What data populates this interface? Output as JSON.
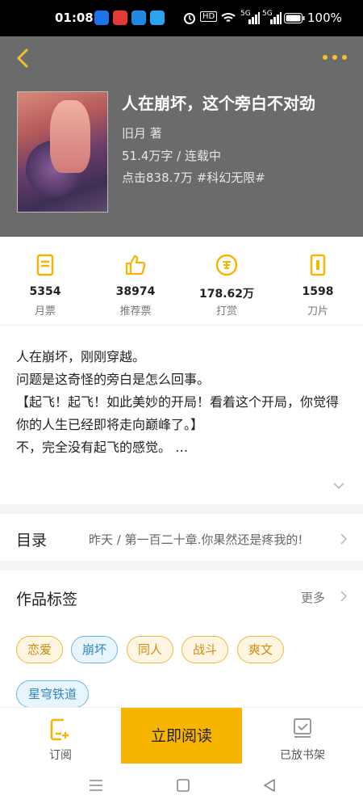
{
  "status_bar": {
    "time": "01:08",
    "battery": "100%",
    "signal_labels": [
      "HD",
      "5G",
      "5G"
    ]
  },
  "book": {
    "title": "人在崩坏，这个旁白不对劲",
    "author": "旧月  著",
    "words_status": "51.4万字 / 连载中",
    "clicks_tag": "点击838.7万  #科幻无限#"
  },
  "stats": [
    {
      "num": "5354",
      "label": "月票",
      "icon": "ticket-icon"
    },
    {
      "num": "38974",
      "label": "推荐票",
      "icon": "thumbs-up-icon"
    },
    {
      "num": "178.62万",
      "label": "打赏",
      "icon": "reward-coin-icon"
    },
    {
      "num": "1598",
      "label": "刀片",
      "icon": "blade-icon"
    }
  ],
  "description": [
    "人在崩坏，刚刚穿越。",
    "问题是这奇怪的旁白是怎么回事。",
    "【起飞！起飞！如此美妙的开局！看着这个开局，你觉得你的人生已经即将走向巅峰了。】",
    "不，完全没有起飞的感觉。 …"
  ],
  "toc": {
    "title": "目录",
    "latest": "昨天 / 第一百二十章.你果然还是疼我的!"
  },
  "tags_section": {
    "title": "作品标签",
    "more": "更多",
    "tags": [
      {
        "label": "恋爱",
        "style": "orange"
      },
      {
        "label": "崩坏",
        "style": "blue"
      },
      {
        "label": "同人",
        "style": "orange"
      },
      {
        "label": "战斗",
        "style": "orange"
      },
      {
        "label": "爽文",
        "style": "orange"
      },
      {
        "label": "星穹铁道",
        "style": "blue"
      }
    ]
  },
  "bottom_bar": {
    "subscribe": "订阅",
    "read_now": "立即阅读",
    "on_shelf": "已放书架"
  },
  "colors": {
    "accent": "#f7b500",
    "header_bg": "#6b6b6b"
  }
}
